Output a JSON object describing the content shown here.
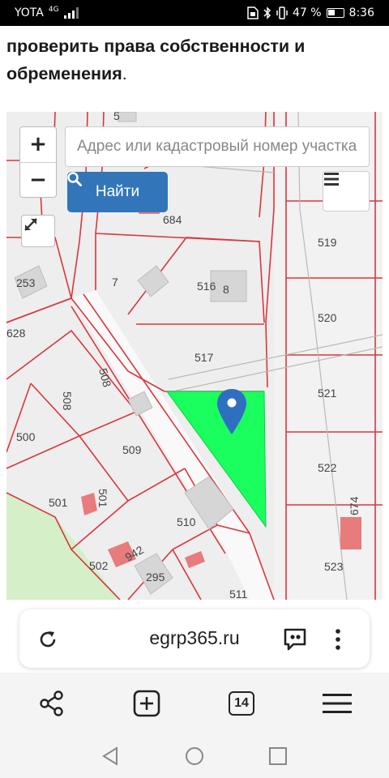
{
  "status_bar": {
    "carrier": "YOTA",
    "network": "4G",
    "battery_percent": "47 %",
    "battery_level": 0.47,
    "time": "8:36",
    "icons": [
      "signal-icon",
      "sim-icon",
      "bluetooth-icon",
      "vibrate-icon",
      "battery-icon"
    ]
  },
  "article": {
    "text": "проверить права собственности и обременения",
    "end_punct": "."
  },
  "map": {
    "zoom_in_label": "+",
    "zoom_out_label": "−",
    "search_placeholder": "Адрес или кадастровый номер участка",
    "search_button_label": "Найти",
    "selected_parcel_color": "#1aff5e",
    "parcel_line_color": "#d9363e",
    "parcel_labels": {
      "p5": "5",
      "p684": "684",
      "p7": "7",
      "p516": "516",
      "p8": "8",
      "p253": "253",
      "p628": "628",
      "p519": "519",
      "p520": "520",
      "p517": "517",
      "p508a": "508",
      "p508b": "508",
      "p521": "521",
      "p500": "500",
      "p509": "509",
      "p522": "522",
      "p501a": "501",
      "p501b": "501",
      "p510": "510",
      "p674": "674",
      "p502": "502",
      "p942": "942",
      "p295": "295",
      "p523": "523",
      "p511": "511"
    },
    "icons": [
      "plus-icon",
      "minus-icon",
      "search-icon",
      "hamburger-icon",
      "expand-icon",
      "location-pin-icon"
    ]
  },
  "browser": {
    "url": "egrp365.ru",
    "icons": [
      "reload-icon",
      "chat-quote-icon",
      "more-vertical-icon"
    ]
  },
  "toolbar": {
    "tabs_count": "14",
    "icons": [
      "share-icon",
      "new-tab-icon",
      "tabs-icon",
      "menu-icon"
    ]
  },
  "navigation": {
    "icons": [
      "back-icon",
      "home-icon",
      "recents-icon"
    ]
  }
}
